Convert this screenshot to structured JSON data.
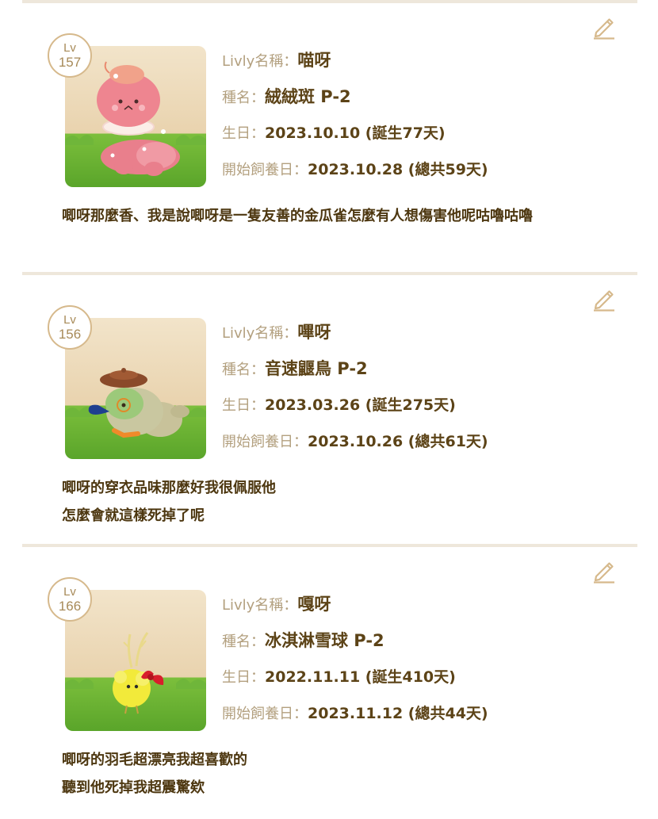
{
  "labels": {
    "level": "Lv",
    "name": "Livly名稱：",
    "species": "種名：",
    "birthday": "生日：",
    "adopt_date": "開始飼養日："
  },
  "colors": {
    "accent": "#d6b98c",
    "label_text": "#b3a07f",
    "value_text": "#5c4317",
    "divider": "#eee7db"
  },
  "pets": [
    {
      "level": "157",
      "name": "喵呀",
      "species": "絨絨斑 P-2",
      "birthday": "2023.10.10 (誕生77天)",
      "adopt_date": "2023.10.28 (總共59天)",
      "description": "唧呀那麼香、我是說唧呀是一隻友善的金瓜雀怎麼有人想傷害他呢咕嚕咕嚕",
      "avatar_icon": "pink-shrimp-livly-icon",
      "edit_icon": "pencil-icon"
    },
    {
      "level": "156",
      "name": "嗶呀",
      "species": "音速鼴鳥 P-2",
      "birthday": "2023.03.26 (誕生275天)",
      "adopt_date": "2023.10.26 (總共61天)",
      "description": "唧呀的穿衣品味那麼好我很佩服他\n怎麼會就這樣死掉了呢",
      "avatar_icon": "beret-bird-livly-icon",
      "edit_icon": "pencil-icon"
    },
    {
      "level": "166",
      "name": "嘎呀",
      "species": "冰淇淋雪球 P-2",
      "birthday": "2022.11.11 (誕生410天)",
      "adopt_date": "2023.11.12 (總共44天)",
      "description": "唧呀的羽毛超漂亮我超喜歡的\n聽到他死掉我超震驚欸",
      "avatar_icon": "yellow-fluffball-livly-icon",
      "edit_icon": "pencil-icon"
    }
  ]
}
